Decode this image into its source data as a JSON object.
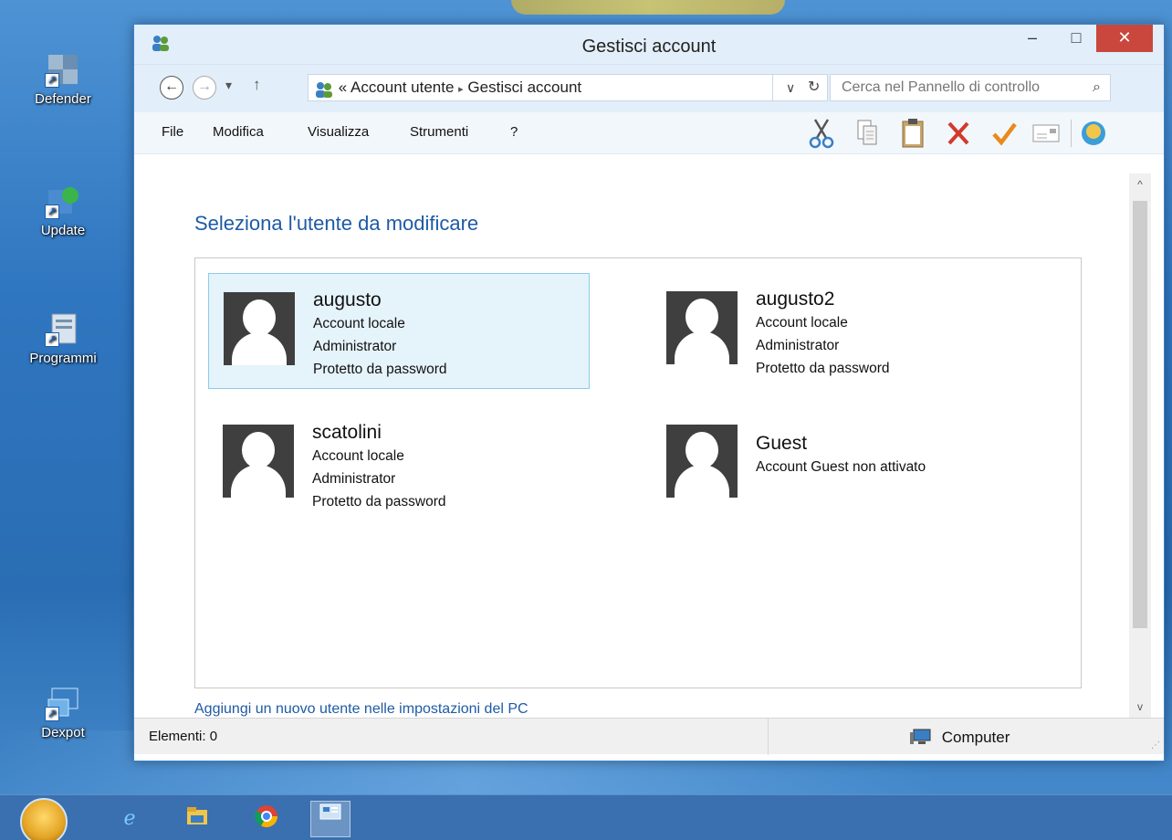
{
  "desktop": {
    "icons": [
      {
        "label": "Defender"
      },
      {
        "label": "Update"
      },
      {
        "label": "Programmi"
      },
      {
        "label": "Dexpot"
      }
    ]
  },
  "window": {
    "title": "Gestisci account",
    "controls": {
      "minimize": "–",
      "maximize": "□",
      "close": "✕"
    }
  },
  "address": {
    "back": "←",
    "forward": "→",
    "recent": "▾",
    "up": "↑",
    "prefix": "«",
    "crumbs": [
      "Account utente",
      "Gestisci account"
    ],
    "separator": "▸",
    "dropdown": "∨",
    "refresh": "↻",
    "search_placeholder": "Cerca nel Pannello di controllo",
    "search_icon": "⌕"
  },
  "menu": {
    "items": [
      "File",
      "Modifica",
      "Visualizza",
      "Strumenti",
      "?"
    ]
  },
  "toolbar": {
    "tools": [
      {
        "name": "cut-icon",
        "glyph": "✂",
        "color": "#3a7fc4"
      },
      {
        "name": "copy-icon",
        "glyph": "⎘",
        "color": "#777777"
      },
      {
        "name": "paste-icon",
        "glyph": "📋",
        "color": "#8a6a3a"
      },
      {
        "name": "delete-icon",
        "glyph": "✕",
        "color": "#d13a2a"
      },
      {
        "name": "check-icon",
        "glyph": "✔",
        "color": "#e98a1a"
      },
      {
        "name": "properties-icon",
        "glyph": "▭",
        "color": "#777777"
      }
    ]
  },
  "main": {
    "heading": "Seleziona l'utente da modificare",
    "users": [
      {
        "name": "augusto",
        "lines": [
          "Account locale",
          "Administrator",
          "Protetto da password"
        ],
        "selected": true
      },
      {
        "name": "augusto2",
        "lines": [
          "Account locale",
          "Administrator",
          "Protetto da password"
        ],
        "selected": false
      },
      {
        "name": "scatolini",
        "lines": [
          "Account locale",
          "Administrator",
          "Protetto da password"
        ],
        "selected": false
      },
      {
        "name": "Guest",
        "lines": [
          "Account Guest non attivato"
        ],
        "selected": false
      }
    ],
    "add_link": "Aggiungi un nuovo utente nelle impostazioni del PC"
  },
  "scrollbar": {
    "up": "^",
    "down": "v"
  },
  "status": {
    "items": "Elementi: 0",
    "location": "Computer"
  },
  "colors": {
    "accent": "#1e5ba5",
    "selection": "#e5f3fb",
    "close_button": "#c9473d"
  }
}
